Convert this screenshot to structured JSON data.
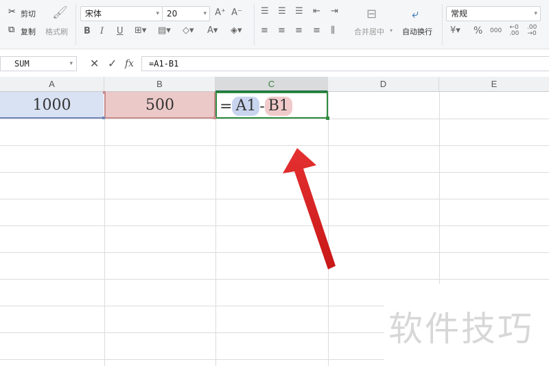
{
  "ribbon": {
    "clipboard": {
      "cut": "剪切",
      "copy": "复制",
      "format_painter": "格式刷"
    },
    "font": {
      "name": "宋体",
      "size": "20"
    },
    "alignment": {
      "merge_center": "合并居中",
      "wrap_text": "自动换行"
    },
    "number": {
      "format": "常规",
      "percent": "%",
      "thousands": "000"
    }
  },
  "formula_bar": {
    "name_box": "SUM",
    "fx": "fx",
    "formula": "=A1-B1"
  },
  "columns": [
    "A",
    "B",
    "C",
    "D",
    "E"
  ],
  "cells": {
    "A1": "1000",
    "B1": "500",
    "C1": {
      "eq": "=",
      "ref1": "A1",
      "op": "-",
      "ref2": "B1"
    }
  },
  "watermark": "软件技巧",
  "colors": {
    "ref_a_fill": "#d9e2f3",
    "ref_b_fill": "#ecc9c9",
    "active_border": "#2e8b3f",
    "arrow": "#e02020"
  }
}
